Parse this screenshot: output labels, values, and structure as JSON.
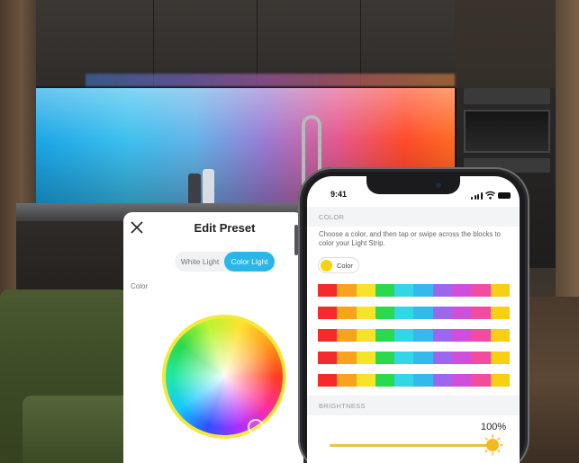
{
  "edit_preset": {
    "title": "Edit Preset",
    "tabs": [
      "White Light",
      "Color Light"
    ],
    "active_tab": "Color Light",
    "color_label": "Color"
  },
  "phone": {
    "status_time": "9:41",
    "color_section": {
      "label": "COLOR",
      "instructions": "Choose a color, and then tap or swipe across the blocks to color your Light Strip.",
      "selected_chip": {
        "label": "Color",
        "color": "#f5d40a"
      }
    },
    "palette": [
      "#f52a2a",
      "#f8a21e",
      "#f6e32a",
      "#2bd94f",
      "#33d6e7",
      "#35b8ec",
      "#9b67ef",
      "#cf4fdc",
      "#f24ba0",
      "#f8cf13"
    ],
    "palette_rows": 5,
    "brightness_section": {
      "label": "BRIGHTNESS",
      "percent": "100%",
      "level": 1.0
    }
  },
  "colors": {
    "accent": "#29b6e8",
    "wheel_ring": "#f3e93c",
    "slider": "#f5b820"
  }
}
